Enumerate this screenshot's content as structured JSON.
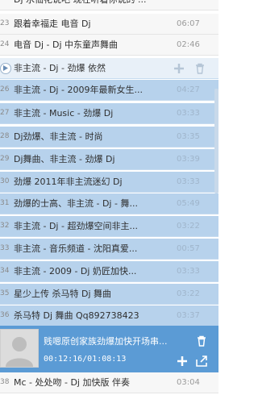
{
  "playlist": [
    {
      "num": "",
      "title": "Dj 水仙花说吧 现在听着你说的 ...",
      "time": ""
    },
    {
      "num": "23",
      "title": "跟着幸福走 电音 Dj",
      "time": "06:07"
    },
    {
      "num": "24",
      "title": "电音 Dj - Dj 中东童声舞曲",
      "time": "02:46"
    },
    {
      "num": "",
      "title": "非主流 - Dj - 劲爆 依然",
      "time": ""
    },
    {
      "num": "26",
      "title": "非主流 - Dj - 2009年最新女生...",
      "time": "04:27"
    },
    {
      "num": "27",
      "title": "非主流 - Music - 劲爆 Dj",
      "time": "03:33"
    },
    {
      "num": "28",
      "title": "Dj劲爆、非主流 - 时尚",
      "time": "03:35"
    },
    {
      "num": "29",
      "title": "Dj舞曲、非主流 - 劲爆 Dj",
      "time": "03:39"
    },
    {
      "num": "30",
      "title": "劲爆 2011年非主流迷幻 Dj",
      "time": "03:33"
    },
    {
      "num": "31",
      "title": "劲爆的士高、非主流 - Dj - 舞...",
      "time": "05:49"
    },
    {
      "num": "32",
      "title": "非主流 - Dj - 超劲爆空间非主...",
      "time": "03:22"
    },
    {
      "num": "33",
      "title": "非主流 - 音乐频道 - 沈阳真爱...",
      "time": "00:57"
    },
    {
      "num": "34",
      "title": "非主流 - 2009 - Dj 奶匠加快...",
      "time": "03:33"
    },
    {
      "num": "35",
      "title": "星少上传 杀马特 Dj 舞曲",
      "time": "03:22"
    },
    {
      "num": "36",
      "title": "杀马特 Dj 舞曲 Qq892738423",
      "time": "03:37"
    },
    {
      "num": "38",
      "title": "Mc - 处处吻 - Dj 加快版 伴奏",
      "time": "03:04"
    }
  ],
  "now_playing": {
    "title": "贱嗯原创家族劲爆加快开场串...",
    "time": "00:12:16/01:08:13"
  },
  "icons": {
    "add": "plus-icon",
    "delete": "trash-icon",
    "share": "share-icon",
    "play": "play-icon",
    "avatar": "user-avatar-icon"
  },
  "colors": {
    "selection": "#b7d2ec",
    "now_playing_bar": "#5b9bd5"
  }
}
